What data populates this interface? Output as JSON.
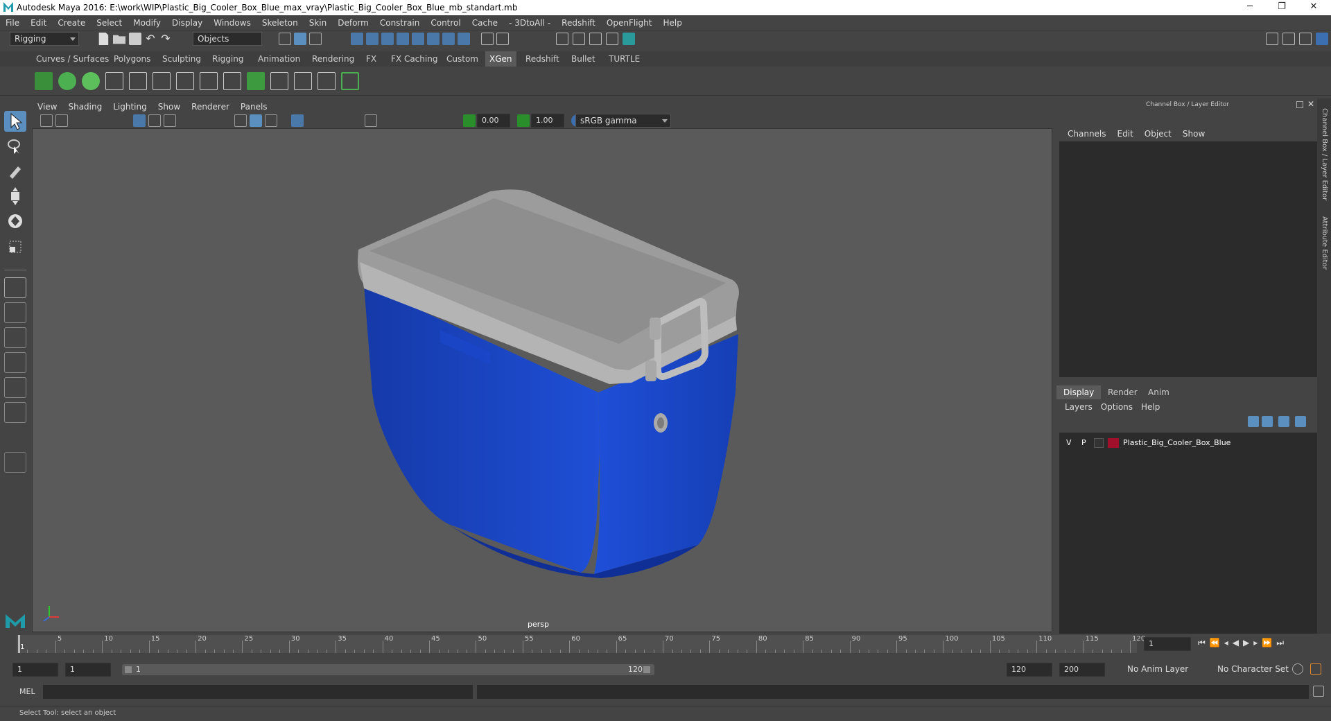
{
  "window": {
    "title": "Autodesk Maya 2016: E:\\work\\WIP\\Plastic_Big_Cooler_Box_Blue_max_vray\\Plastic_Big_Cooler_Box_Blue_mb_standart.mb",
    "minimize": "─",
    "maximize": "❐",
    "close": "✕"
  },
  "menubar": [
    "File",
    "Edit",
    "Create",
    "Select",
    "Modify",
    "Display",
    "Windows",
    "Skeleton",
    "Skin",
    "Deform",
    "Constrain",
    "Control",
    "Cache",
    "- 3DtoAll -",
    "Redshift",
    "OpenFlight",
    "Help"
  ],
  "statusline": {
    "mode": "Rigging",
    "selection_mode": "Objects"
  },
  "shelf_tabs": [
    "Curves / Surfaces",
    "Polygons",
    "Sculpting",
    "Rigging",
    "Animation",
    "Rendering",
    "FX",
    "FX Caching",
    "Custom",
    "XGen",
    "Redshift",
    "Bullet",
    "TURTLE"
  ],
  "shelf_active_tab": "XGen",
  "viewport": {
    "menu": [
      "View",
      "Shading",
      "Lighting",
      "Show",
      "Renderer",
      "Panels"
    ],
    "exposure": "0.00",
    "gamma": "1.00",
    "color_space": "sRGB gamma",
    "camera_label": "persp"
  },
  "channel_box": {
    "title": "Channel Box / Layer Editor",
    "menu": [
      "Channels",
      "Edit",
      "Object",
      "Show"
    ],
    "side_tab_1": "Channel Box / Layer Editor",
    "side_tab_2": "Attribute Editor"
  },
  "layer_editor": {
    "tabs": [
      "Display",
      "Render",
      "Anim"
    ],
    "active_tab": "Display",
    "menu": [
      "Layers",
      "Options",
      "Help"
    ],
    "layers": [
      {
        "visible": "V",
        "playback": "P",
        "name": "Plastic_Big_Cooler_Box_Blue",
        "color": "#a0102a"
      }
    ]
  },
  "timeline": {
    "ticks": [
      "1",
      "5",
      "10",
      "15",
      "20",
      "25",
      "30",
      "35",
      "40",
      "45",
      "50",
      "55",
      "60",
      "65",
      "70",
      "75",
      "80",
      "85",
      "90",
      "95",
      "100",
      "105",
      "110",
      "115",
      "120"
    ],
    "current_frame": "1",
    "start": 1,
    "end": 120
  },
  "range": {
    "start_field": "1",
    "start_field2": "1",
    "range_start_label": "1",
    "range_end_label": "120",
    "end_field": "120",
    "end_field2": "200",
    "anim_layer": "No Anim Layer",
    "character_set": "No Character Set"
  },
  "command_line": {
    "label": "MEL"
  },
  "help_line": "Select Tool: select an object",
  "colors": {
    "cooler_body": "#1b3fb0",
    "cooler_lid": "#9a9a9a",
    "viewport_bg": "#5a5a5a",
    "layer_color": "#a0102a"
  }
}
